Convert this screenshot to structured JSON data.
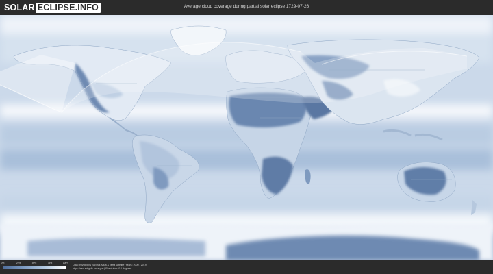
{
  "header": {
    "logo_solar": "SOLAR",
    "logo_eclipse": "ECLIPSE.INFO",
    "title": "Average cloud coverage during partial solar eclipse 1729-07-26"
  },
  "map": {
    "projection": "equirectangular",
    "layer": "cloud-coverage",
    "colors": {
      "clear": "#4f6d99",
      "cloudy": "#ffffff",
      "ocean_base": "#c9d8ea",
      "eclipse_shade": "#ffffff"
    }
  },
  "legend": {
    "ticks": [
      "0%",
      "25%",
      "50%",
      "75%",
      "100%"
    ],
    "ticks_fraction": [
      0,
      0.25,
      0.5,
      0.75,
      1.0
    ],
    "colors": [
      "#4f6d99",
      "#7e9cc2",
      "#b4c9e0",
      "#ffffff"
    ]
  },
  "credit": {
    "line1": "Data provided by NASA's Aqua & Terra satellite (Years: 2000 - 2019)",
    "line2": "https://neo.sci.gsfc.nasa.gov | Resolution: 0.1 degrees"
  }
}
